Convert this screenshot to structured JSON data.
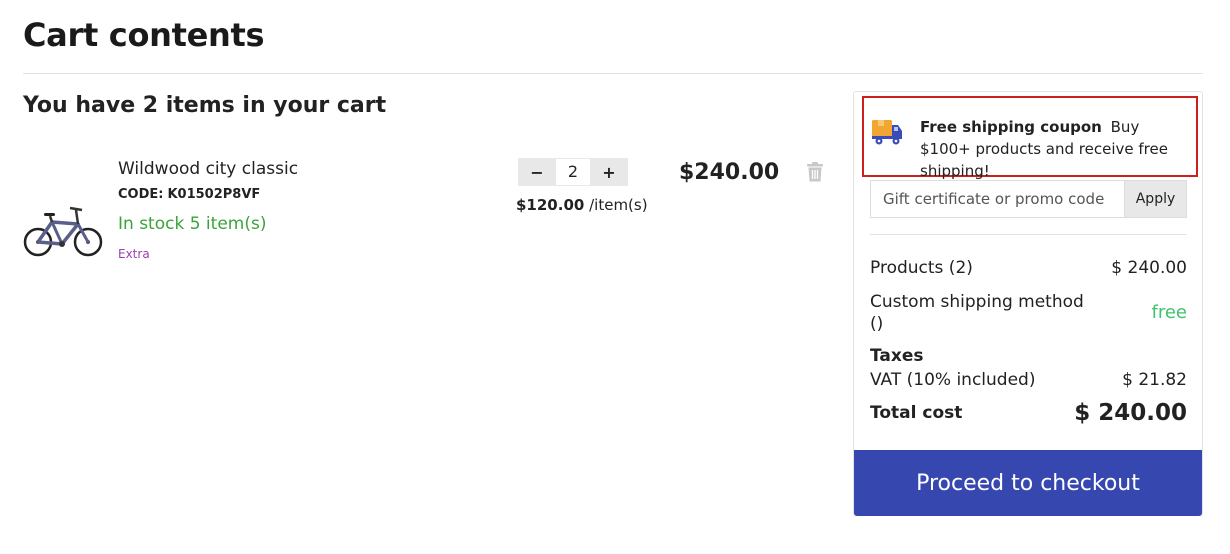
{
  "page": {
    "title": "Cart contents",
    "cart_heading": "You have 2 items in your cart"
  },
  "item": {
    "name": "Wildwood city classic",
    "code_label": "CODE:",
    "code": "K01502P8VF",
    "stock": "In stock 5 item(s)",
    "extra": "Extra",
    "quantity": "2",
    "qty_minus": "−",
    "qty_plus": "+",
    "unit_price": "$120.00",
    "unit_suffix": "/item(s)",
    "total": "$240.00",
    "image_icon": "bicycle-icon",
    "delete_icon": "trash-icon"
  },
  "summary": {
    "coupon_icon": "delivery-truck-icon",
    "coupon_title": "Free shipping coupon",
    "coupon_text": "Buy $100+ products and receive free shipping!",
    "promo_placeholder": "Gift certificate or promo code",
    "apply_label": "Apply",
    "products_label": "Products (2)",
    "products_value": "$ 240.00",
    "shipping_label": "Custom shipping method ()",
    "shipping_value": "free",
    "taxes_label": "Taxes",
    "vat_label": "VAT (10% included)",
    "vat_value": "$ 21.82",
    "total_label": "Total cost",
    "total_value": "$ 240.00",
    "checkout_label": "Proceed to checkout"
  },
  "colors": {
    "accent": "#3747b0",
    "stock": "#3aa43a",
    "free": "#3fc26e",
    "extra": "#9b3fb5",
    "coupon_border": "#cc1f1f"
  }
}
